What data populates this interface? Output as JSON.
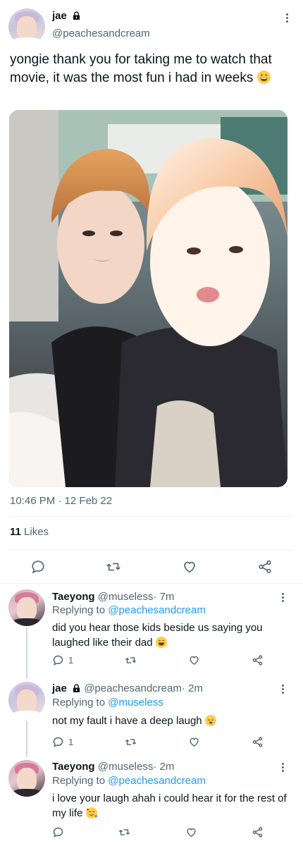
{
  "main_tweet": {
    "display_name": "jae",
    "handle": "@peachesandcream",
    "text": "yongie thank you for taking me to watch that movie, it was the most fun i had in weeks",
    "time": "10:46 PM",
    "dot": "·",
    "date": "12 Feb 22",
    "likes_count": "11",
    "likes_label": "Likes"
  },
  "replies": [
    {
      "display_name": "Taeyong",
      "handle": "@museless",
      "dot": "·",
      "time": "7m",
      "replying_label": "Replying to",
      "replying_to": "@peachesandcream",
      "text": "did you hear those kids beside us saying you laughed like their dad",
      "reply_count": "1"
    },
    {
      "display_name": "jae",
      "handle": "@peachesandcream",
      "dot": "·",
      "time": "2m",
      "replying_label": "Replying to",
      "replying_to": "@museless",
      "text": "not my fault i have a deep laugh",
      "reply_count": "1"
    },
    {
      "display_name": "Taeyong",
      "handle": "@museless",
      "dot": "·",
      "time": "2m",
      "replying_label": "Replying to",
      "replying_to": "@peachesandcream",
      "text": "i love your laugh ahah i could hear it for the rest of my life",
      "reply_count": ""
    }
  ],
  "icons": {
    "reply": "reply-icon",
    "retweet": "retweet-icon",
    "like": "heart-icon",
    "share": "share-icon",
    "more": "more-icon",
    "lock": "lock-icon"
  },
  "colors": {
    "link": "#1d9bf0",
    "muted": "#536471",
    "text": "#0f1419"
  }
}
